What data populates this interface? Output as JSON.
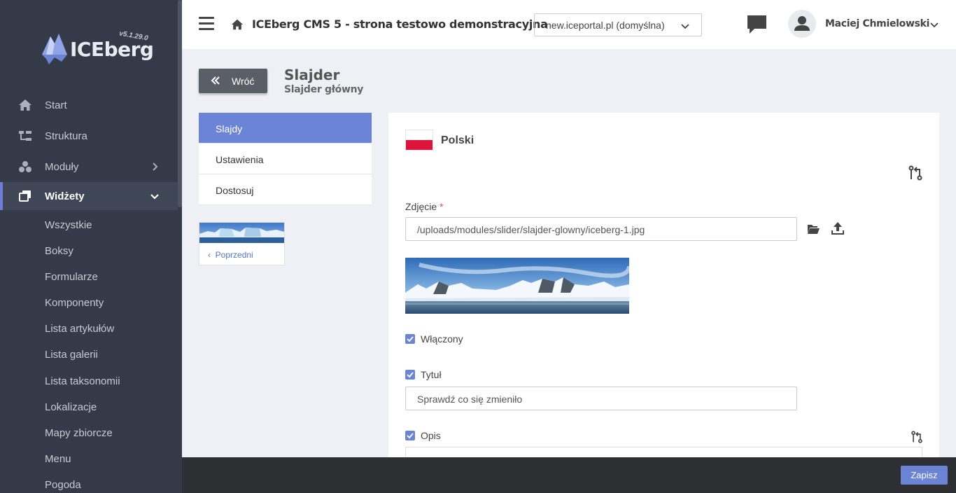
{
  "brand": {
    "name": "ICEberg",
    "version": "v5.1.29.0"
  },
  "sidebar": {
    "items": [
      {
        "label": "Start",
        "icon": "home-icon"
      },
      {
        "label": "Struktura",
        "icon": "structure-icon"
      },
      {
        "label": "Moduły",
        "icon": "modules-icon"
      },
      {
        "label": "Widżety",
        "icon": "widgets-icon",
        "active": true
      }
    ],
    "sub_items": [
      "Wszystkie",
      "Boksy",
      "Formularze",
      "Komponenty",
      "Lista artykułów",
      "Lista galerii",
      "Lista taksonomii",
      "Lokalizacje",
      "Mapy zbiorcze",
      "Menu",
      "Pogoda"
    ]
  },
  "header": {
    "site_title": "ICEberg CMS 5 - strona testowo demonstracyjna",
    "domain": "new.iceportal.pl (domyślna)",
    "user_name": "Maciej Chmielowski"
  },
  "page": {
    "back_label": "Wróć",
    "title": "Slajder",
    "subtitle": "Slajder główny"
  },
  "tabs": [
    {
      "label": "Slajdy",
      "active": true
    },
    {
      "label": "Ustawienia"
    },
    {
      "label": "Dostosuj"
    }
  ],
  "prev_label": "Poprzedni",
  "form": {
    "language": "Polski",
    "image_label": "Zdjęcie",
    "required_mark": "*",
    "image_path": "/uploads/modules/slider/slajder-glowny/iceberg-1.jpg",
    "enabled_label": "Włączony",
    "enabled": true,
    "title_label": "Tytuł",
    "title_checked": true,
    "title_value": "Sprawdź co się zmieniło",
    "desc_label": "Opis",
    "desc_checked": true
  },
  "footer": {
    "save_label": "Zapisz"
  },
  "colors": {
    "accent": "#6c84d6",
    "sidebar": "#343a48",
    "footer": "#2d2f33",
    "flag_red": "#dc143c"
  }
}
